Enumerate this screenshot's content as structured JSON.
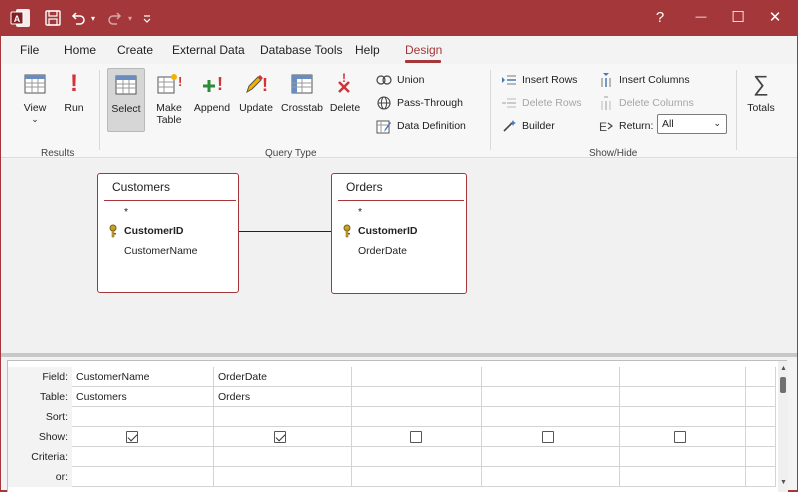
{
  "titlebar": {
    "help_label": "?",
    "minimize_glyph": "—",
    "maximize_glyph": "☐",
    "close_glyph": "✕"
  },
  "tabs": [
    {
      "label": "File"
    },
    {
      "label": "Home"
    },
    {
      "label": "Create"
    },
    {
      "label": "External Data"
    },
    {
      "label": "Database Tools"
    },
    {
      "label": "Help"
    },
    {
      "label": "Design",
      "active": true
    }
  ],
  "ribbon": {
    "results": {
      "label": "Results",
      "view": "View",
      "run": "Run"
    },
    "query_type": {
      "label": "Query Type",
      "select": "Select",
      "make_table_1": "Make",
      "make_table_2": "Table",
      "append": "Append",
      "update": "Update",
      "crosstab": "Crosstab",
      "delete": "Delete",
      "union": "Union",
      "pass_through": "Pass-Through",
      "data_definition": "Data Definition"
    },
    "setup": {
      "insert_rows": "Insert Rows",
      "delete_rows": "Delete Rows",
      "builder": "Builder",
      "insert_columns": "Insert Columns",
      "delete_columns": "Delete Columns",
      "return_label": "Return:",
      "return_value": "All"
    },
    "show_hide": {
      "label": "Show/Hide",
      "totals": "Totals"
    }
  },
  "tables": {
    "customers": {
      "name": "Customers",
      "all": "*",
      "key_field": "CustomerID",
      "field2": "CustomerName"
    },
    "orders": {
      "name": "Orders",
      "all": "*",
      "key_field": "CustomerID",
      "field2": "OrderDate"
    }
  },
  "grid": {
    "row_labels": {
      "field": "Field:",
      "table": "Table:",
      "sort": "Sort:",
      "show": "Show:",
      "criteria": "Criteria:",
      "or": "or:"
    },
    "columns": [
      {
        "field": "CustomerName",
        "table": "Customers",
        "show": true
      },
      {
        "field": "OrderDate",
        "table": "Orders",
        "show": true
      },
      {
        "field": "",
        "table": "",
        "show": false
      },
      {
        "field": "",
        "table": "",
        "show": false
      },
      {
        "field": "",
        "table": "",
        "show": false
      }
    ]
  },
  "colors": {
    "accent": "#a4373a"
  }
}
